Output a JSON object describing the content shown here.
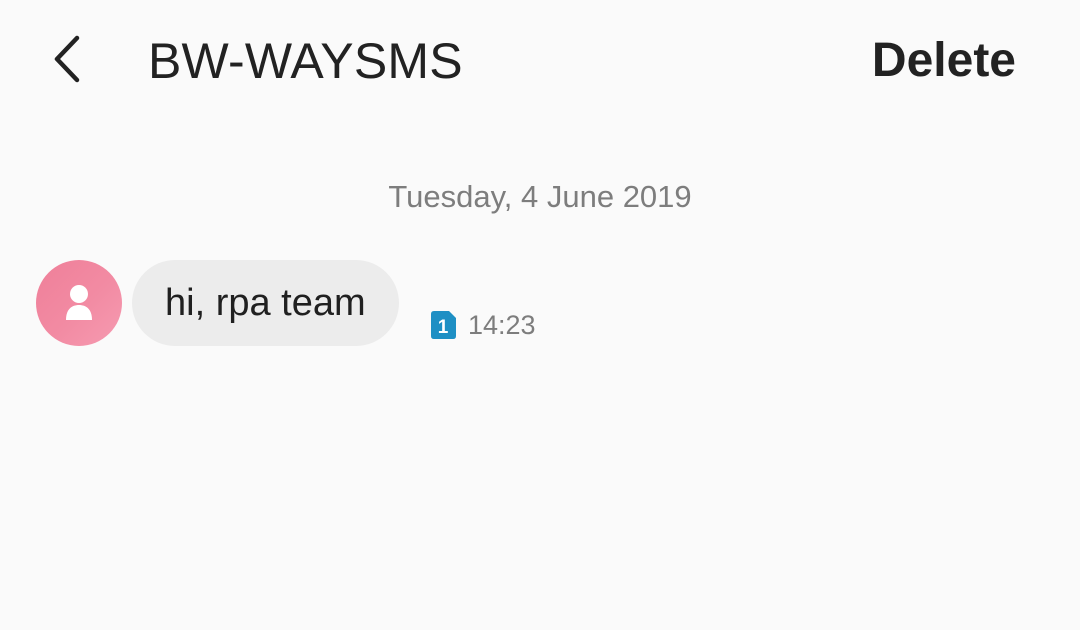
{
  "header": {
    "back_icon": "chevron-left-icon",
    "title": "BW-WAYSMS",
    "delete_label": "Delete"
  },
  "conversation": {
    "date_label": "Tuesday, 4 June 2019",
    "messages": [
      {
        "direction": "incoming",
        "avatar_icon": "person-icon",
        "text": "hi, rpa team",
        "sim_badge": "1",
        "sim_icon": "sim-1-icon",
        "time": "14:23"
      }
    ]
  },
  "colors": {
    "background": "#fafafa",
    "text_primary": "#222222",
    "text_secondary": "#7d7d7d",
    "bubble_incoming": "#ececec",
    "avatar": "#f28ba3",
    "sim_badge": "#1e8fc4"
  }
}
